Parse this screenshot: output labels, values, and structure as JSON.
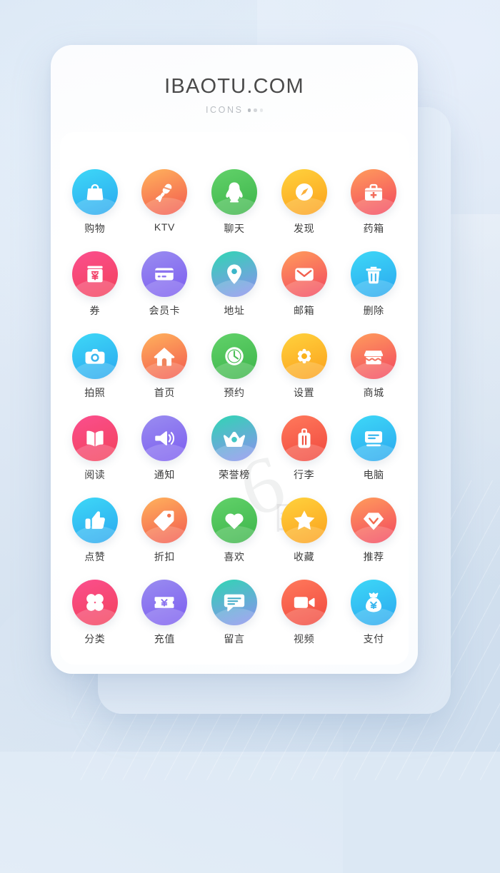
{
  "header": {
    "brand": "IBAOTU.COM",
    "subtitle": "ICONS",
    "dots": "•••"
  },
  "watermark": {
    "mark": "6",
    "text": "图"
  },
  "colors": {
    "page_background": "#dce8f4",
    "card_background": "#ffffff",
    "back_card": "#e6f0fa",
    "label_text": "#3c3c3c",
    "brand_text": "#4a4a4a",
    "subtitle_text": "#b9bdc2",
    "cyan_from": "#3ed8f7",
    "cyan_to": "#2aa7ef",
    "orange_from": "#ffb35c",
    "orange_to": "#f2584f",
    "green_from": "#62d26a",
    "green_to": "#3cb44a",
    "yellow_from": "#ffd23d",
    "yellow_to": "#fba01c",
    "salmon_from": "#ff9d5c",
    "salmon_to": "#f2455f",
    "pink_from": "#fb4f8e",
    "pink_to": "#f2415a",
    "purple_from": "#9a8df0",
    "purple_to": "#7b5cf0",
    "teal_from": "#2fd6b3",
    "teal_to": "#8f8ef0",
    "red_from": "#ff7a5c",
    "red_to": "#f0473e"
  },
  "grid": {
    "columns": 5,
    "rows": 6,
    "icons": [
      {
        "label": "购物",
        "icon": "shopping-bag-icon",
        "theme": "cyan"
      },
      {
        "label": "KTV",
        "icon": "microphone-icon",
        "theme": "orange"
      },
      {
        "label": "聊天",
        "icon": "penguin-chat-icon",
        "theme": "green"
      },
      {
        "label": "发现",
        "icon": "compass-icon",
        "theme": "yellow"
      },
      {
        "label": "药箱",
        "icon": "medical-kit-icon",
        "theme": "salmon"
      },
      {
        "label": "券",
        "icon": "coupon-yuan-icon",
        "theme": "pink"
      },
      {
        "label": "会员卡",
        "icon": "membership-card-icon",
        "theme": "purple"
      },
      {
        "label": "地址",
        "icon": "location-pin-icon",
        "theme": "teal"
      },
      {
        "label": "邮箱",
        "icon": "mail-envelope-icon",
        "theme": "salmon"
      },
      {
        "label": "删除",
        "icon": "trash-delete-icon",
        "theme": "cyan"
      },
      {
        "label": "拍照",
        "icon": "camera-icon",
        "theme": "cyan"
      },
      {
        "label": "首页",
        "icon": "home-icon",
        "theme": "orange"
      },
      {
        "label": "预约",
        "icon": "clock-appointment-icon",
        "theme": "green"
      },
      {
        "label": "设置",
        "icon": "gear-settings-icon",
        "theme": "yellow"
      },
      {
        "label": "商城",
        "icon": "store-shop-icon",
        "theme": "salmon"
      },
      {
        "label": "阅读",
        "icon": "open-book-icon",
        "theme": "pink"
      },
      {
        "label": "通知",
        "icon": "speaker-notification-icon",
        "theme": "purple"
      },
      {
        "label": "荣誉榜",
        "icon": "crown-honor-icon",
        "theme": "teal"
      },
      {
        "label": "行李",
        "icon": "luggage-icon",
        "theme": "red"
      },
      {
        "label": "电脑",
        "icon": "computer-monitor-icon",
        "theme": "cyan"
      },
      {
        "label": "点赞",
        "icon": "thumbs-up-icon",
        "theme": "cyan"
      },
      {
        "label": "折扣",
        "icon": "discount-tag-icon",
        "theme": "orange"
      },
      {
        "label": "喜欢",
        "icon": "heart-like-icon",
        "theme": "green"
      },
      {
        "label": "收藏",
        "icon": "star-favorite-icon",
        "theme": "yellow"
      },
      {
        "label": "推荐",
        "icon": "diamond-recommend-icon",
        "theme": "salmon"
      },
      {
        "label": "分类",
        "icon": "category-clover-icon",
        "theme": "pink"
      },
      {
        "label": "充值",
        "icon": "recharge-ticket-icon",
        "theme": "purple"
      },
      {
        "label": "留言",
        "icon": "message-comment-icon",
        "theme": "teal"
      },
      {
        "label": "视频",
        "icon": "video-camera-icon",
        "theme": "red"
      },
      {
        "label": "支付",
        "icon": "money-bag-pay-icon",
        "theme": "cyan"
      }
    ]
  }
}
